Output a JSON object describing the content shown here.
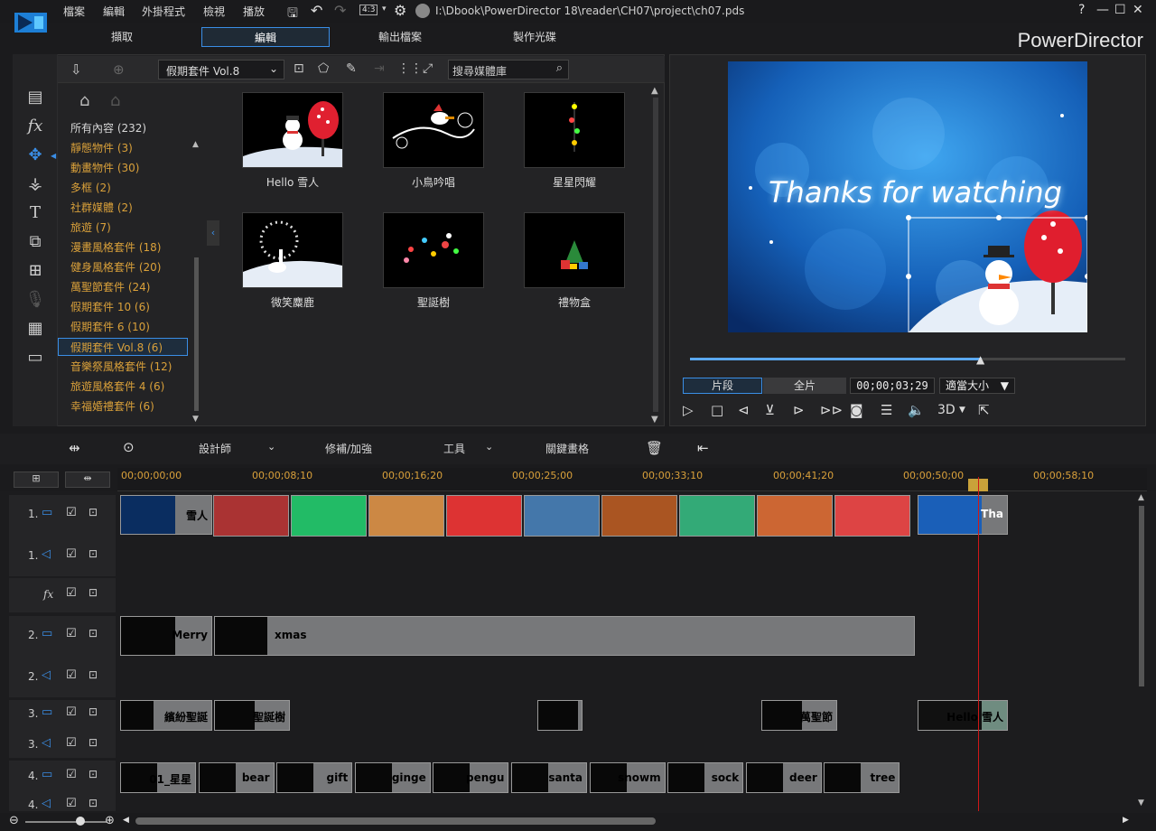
{
  "menu": [
    "檔案",
    "編輯",
    "外掛程式",
    "檢視",
    "播放"
  ],
  "aspect": "4:3",
  "project_path": "I:\\Dbook\\PowerDirector 18\\reader\\CH07\\project\\ch07.pds",
  "brand": "PowerDirector",
  "window_controls": [
    "?",
    "—",
    "☐",
    "✕"
  ],
  "tabs": [
    "擷取",
    "編輯",
    "輸出檔案",
    "製作光碟"
  ],
  "active_tab": "編輯",
  "library": {
    "pack_dropdown": "假期套件 Vol.8",
    "search_placeholder": "搜尋媒體庫",
    "categories": [
      "所有內容 (232)",
      "靜態物件 (3)",
      "動畫物件 (30)",
      "多框 (2)",
      "社群媒體 (2)",
      "旅遊 (7)",
      "漫畫風格套件 (18)",
      "健身風格套件 (20)",
      "萬聖節套件 (24)",
      "假期套件 10 (6)",
      "假期套件 6 (10)",
      "假期套件 Vol.8 (6)",
      "音樂祭風格套件 (12)",
      "旅遊風格套件 4 (6)",
      "幸福婚禮套件 (6)"
    ],
    "selected_category": "假期套件 Vol.8 (6)",
    "items": [
      "Hello 雪人",
      "小鳥吟唱",
      "星星閃耀",
      "微笑麋鹿",
      "聖誕樹",
      "禮物盒"
    ]
  },
  "preview": {
    "overlay_text": "Thanks for watching",
    "mode_clip": "片段",
    "mode_movie": "全片",
    "timecode": "00;00;03;29",
    "zoom": "適當大小",
    "stereo": "3D",
    "progress": 0.67
  },
  "edit_toolbar": {
    "designer": "設計師",
    "fix": "修補/加強",
    "tools": "工具",
    "keyframe": "關鍵畫格"
  },
  "ruler": [
    "00;00;00;00",
    "00;00;08;10",
    "00;00;16;20",
    "00;00;25;00",
    "00;00;33;10",
    "00;00;41;20",
    "00;00;50;00",
    "00;00;58;10"
  ],
  "tracks": {
    "labels": [
      "1.",
      "1.",
      "fx",
      "2.",
      "2.",
      "3.",
      "3.",
      "4.",
      "4."
    ],
    "track1_clips": [
      "雪人",
      "Tha"
    ],
    "track2_clips": [
      "Merry",
      "xmas"
    ],
    "track3_clips": [
      "繽紛聖誕",
      "聖誕樹",
      "萬聖節",
      "Hello 雪人"
    ],
    "track4_clips": [
      "01_星星",
      "bear",
      "gift",
      "ginge",
      "pengu",
      "santa",
      "snowm",
      "sock",
      "deer",
      "tree"
    ]
  },
  "colors": {
    "accent": "#3a8ee6",
    "category": "#d9a03a",
    "playhead": "#d01818"
  }
}
